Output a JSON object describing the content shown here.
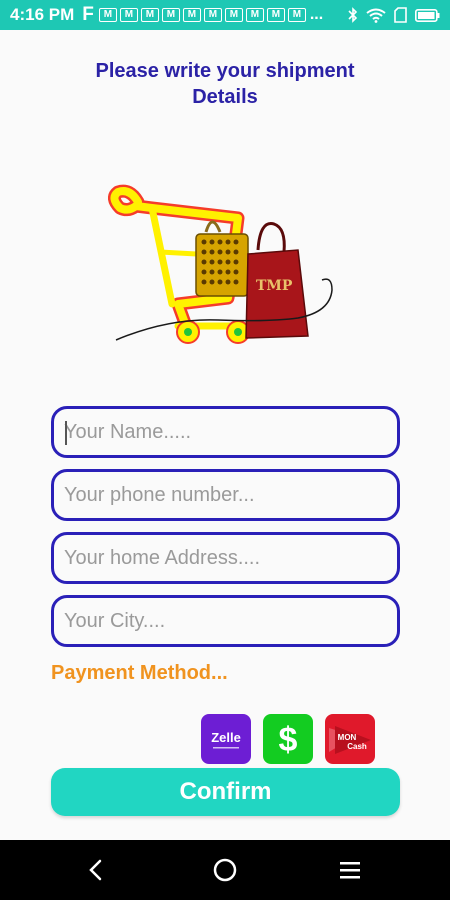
{
  "status_bar": {
    "time": "4:16 PM",
    "f_icon": "F",
    "notification_icon": "M",
    "notification_count": 10,
    "more": "..."
  },
  "title": {
    "line1": "Please write your shipment",
    "line2": "Details"
  },
  "form": {
    "name_placeholder": "Your Name.....",
    "phone_placeholder": "Your phone number...",
    "address_placeholder": "Your home Address....",
    "city_placeholder": "Your City...."
  },
  "payment": {
    "label": "Payment Method...",
    "methods": [
      {
        "name": "zelle",
        "text": "Zelle",
        "color": "#6d1ed4"
      },
      {
        "name": "cashapp",
        "text": "$",
        "color": "#13cc21"
      },
      {
        "name": "moncash",
        "text": "MON Cash",
        "color": "#e0192b"
      }
    ]
  },
  "confirm_label": "Confirm",
  "logo_text": "TMP",
  "colors": {
    "accent": "#1ec8b4",
    "title": "#2b22a6",
    "field_border": "#2a20b8",
    "payment_label": "#f0931f"
  }
}
